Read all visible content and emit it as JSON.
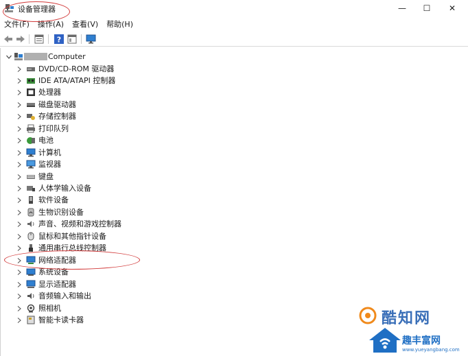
{
  "window": {
    "title": "设备管理器",
    "minimize_glyph": "—",
    "maximize_glyph": "☐",
    "close_glyph": "✕"
  },
  "menu": [
    "文件(F)",
    "操作(A)",
    "查看(V)",
    "帮助(H)"
  ],
  "toolbar": {
    "buttons": [
      "back-arrow-icon",
      "forward-arrow-icon",
      "properties-icon",
      "help-icon",
      "console-tree-icon",
      "monitor-scan-icon"
    ]
  },
  "tree": {
    "root": "Computer",
    "items": [
      {
        "label": "DVD/CD-ROM 驱动器",
        "icon": "dvd-drive-icon"
      },
      {
        "label": "IDE ATA/ATAPI 控制器",
        "icon": "ide-controller-icon"
      },
      {
        "label": "处理器",
        "icon": "processor-icon"
      },
      {
        "label": "磁盘驱动器",
        "icon": "disk-drive-icon"
      },
      {
        "label": "存储控制器",
        "icon": "storage-controller-icon"
      },
      {
        "label": "打印队列",
        "icon": "printer-icon"
      },
      {
        "label": "电池",
        "icon": "battery-icon"
      },
      {
        "label": "计算机",
        "icon": "computer-icon"
      },
      {
        "label": "监视器",
        "icon": "monitor-icon"
      },
      {
        "label": "键盘",
        "icon": "keyboard-icon"
      },
      {
        "label": "人体学输入设备",
        "icon": "hid-icon"
      },
      {
        "label": "软件设备",
        "icon": "software-device-icon"
      },
      {
        "label": "生物识别设备",
        "icon": "biometric-icon"
      },
      {
        "label": "声音、视频和游戏控制器",
        "icon": "sound-icon"
      },
      {
        "label": "鼠标和其他指针设备",
        "icon": "mouse-icon"
      },
      {
        "label": "通用串行总线控制器",
        "icon": "usb-icon"
      },
      {
        "label": "网络适配器",
        "icon": "network-adapter-icon"
      },
      {
        "label": "系统设备",
        "icon": "system-device-icon"
      },
      {
        "label": "显示适配器",
        "icon": "display-adapter-icon"
      },
      {
        "label": "音频输入和输出",
        "icon": "audio-io-icon"
      },
      {
        "label": "照相机",
        "icon": "camera-icon"
      },
      {
        "label": "智能卡读卡器",
        "icon": "smart-card-icon"
      }
    ]
  },
  "watermarks": {
    "top": "酷知网",
    "bottom": "趣丰富网",
    "bottom_url": "www.yueyangbang.com"
  },
  "colors": {
    "annotation": "#d23a3a",
    "icon_blue": "#2f7fd0",
    "watermark_orange": "#f08a1c",
    "watermark_blue": "#1f6fc4"
  }
}
